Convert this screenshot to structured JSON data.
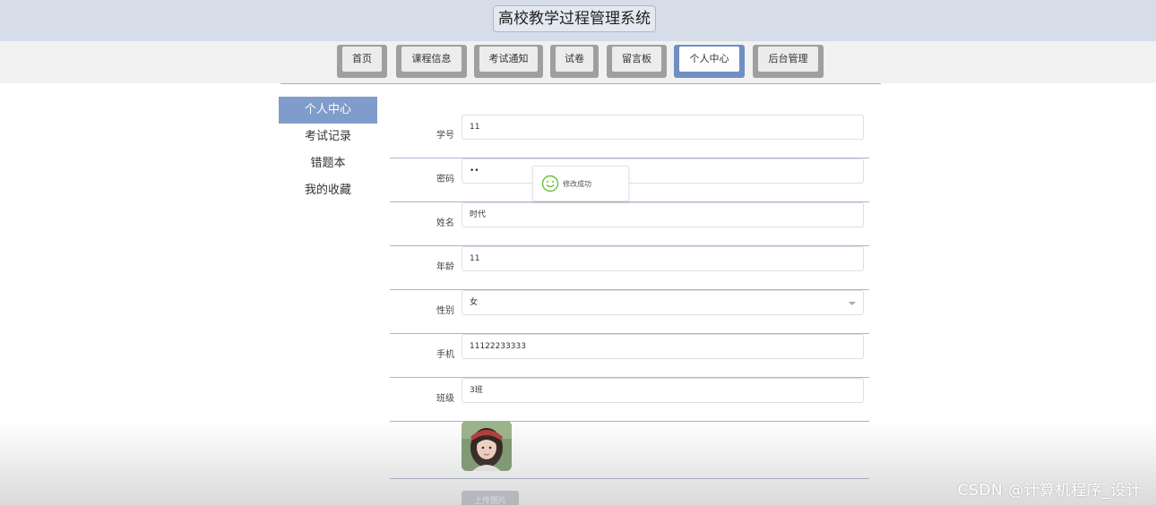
{
  "header": {
    "title": "高校教学过程管理系统"
  },
  "nav": [
    {
      "label": "首页"
    },
    {
      "label": "课程信息"
    },
    {
      "label": "考试通知"
    },
    {
      "label": "试卷"
    },
    {
      "label": "留言板"
    },
    {
      "label": "个人中心",
      "active": true
    },
    {
      "label": "后台管理"
    }
  ],
  "sidebar": [
    {
      "label": "个人中心",
      "active": true
    },
    {
      "label": "考试记录"
    },
    {
      "label": "错题本"
    },
    {
      "label": "我的收藏"
    }
  ],
  "form": {
    "student_id": {
      "label": "学号",
      "value": "11"
    },
    "password": {
      "label": "密码",
      "value": "••"
    },
    "name": {
      "label": "姓名",
      "value": "时代"
    },
    "age": {
      "label": "年龄",
      "value": "11"
    },
    "gender": {
      "label": "性别",
      "value": "女"
    },
    "phone": {
      "label": "手机",
      "value": "11122233333"
    },
    "class": {
      "label": "班级",
      "value": "3班"
    }
  },
  "toast": {
    "message": "修改成功"
  },
  "upload": {
    "label": "上传图片"
  },
  "watermark": "CSDN @计算机程序_设计",
  "colors": {
    "header_bg": "#d6dde9",
    "accent": "#7f9cca",
    "success": "#67c23a"
  }
}
